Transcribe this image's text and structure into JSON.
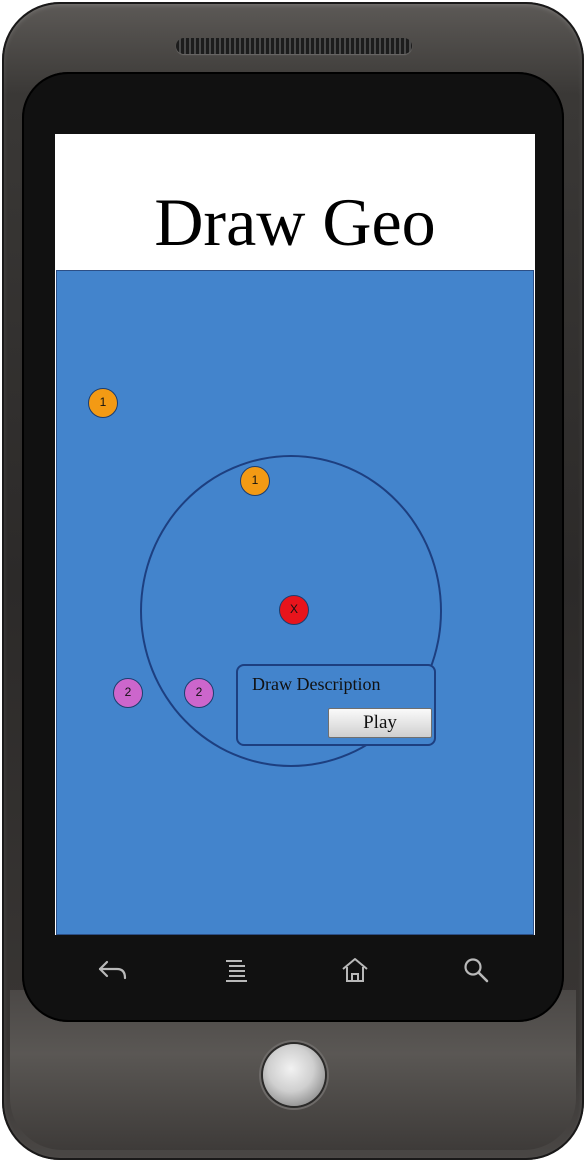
{
  "app": {
    "title": "Draw Geo"
  },
  "map": {
    "background_color": "#4384cc",
    "markers": [
      {
        "name": "marker-orange-1-outside",
        "label": "1",
        "color": "#f39a14"
      },
      {
        "name": "marker-orange-1-inside",
        "label": "1",
        "color": "#f39a14"
      },
      {
        "name": "marker-center-x",
        "label": "X",
        "color": "#e8141c"
      },
      {
        "name": "marker-purple-2-outside",
        "label": "2",
        "color": "#cc66cc"
      },
      {
        "name": "marker-purple-2-inside",
        "label": "2",
        "color": "#cc66cc"
      }
    ]
  },
  "popup": {
    "title": "Draw Description",
    "play_label": "Play"
  },
  "navbar": {
    "icons": [
      "back-icon",
      "menu-icon",
      "home-icon",
      "search-icon"
    ]
  }
}
